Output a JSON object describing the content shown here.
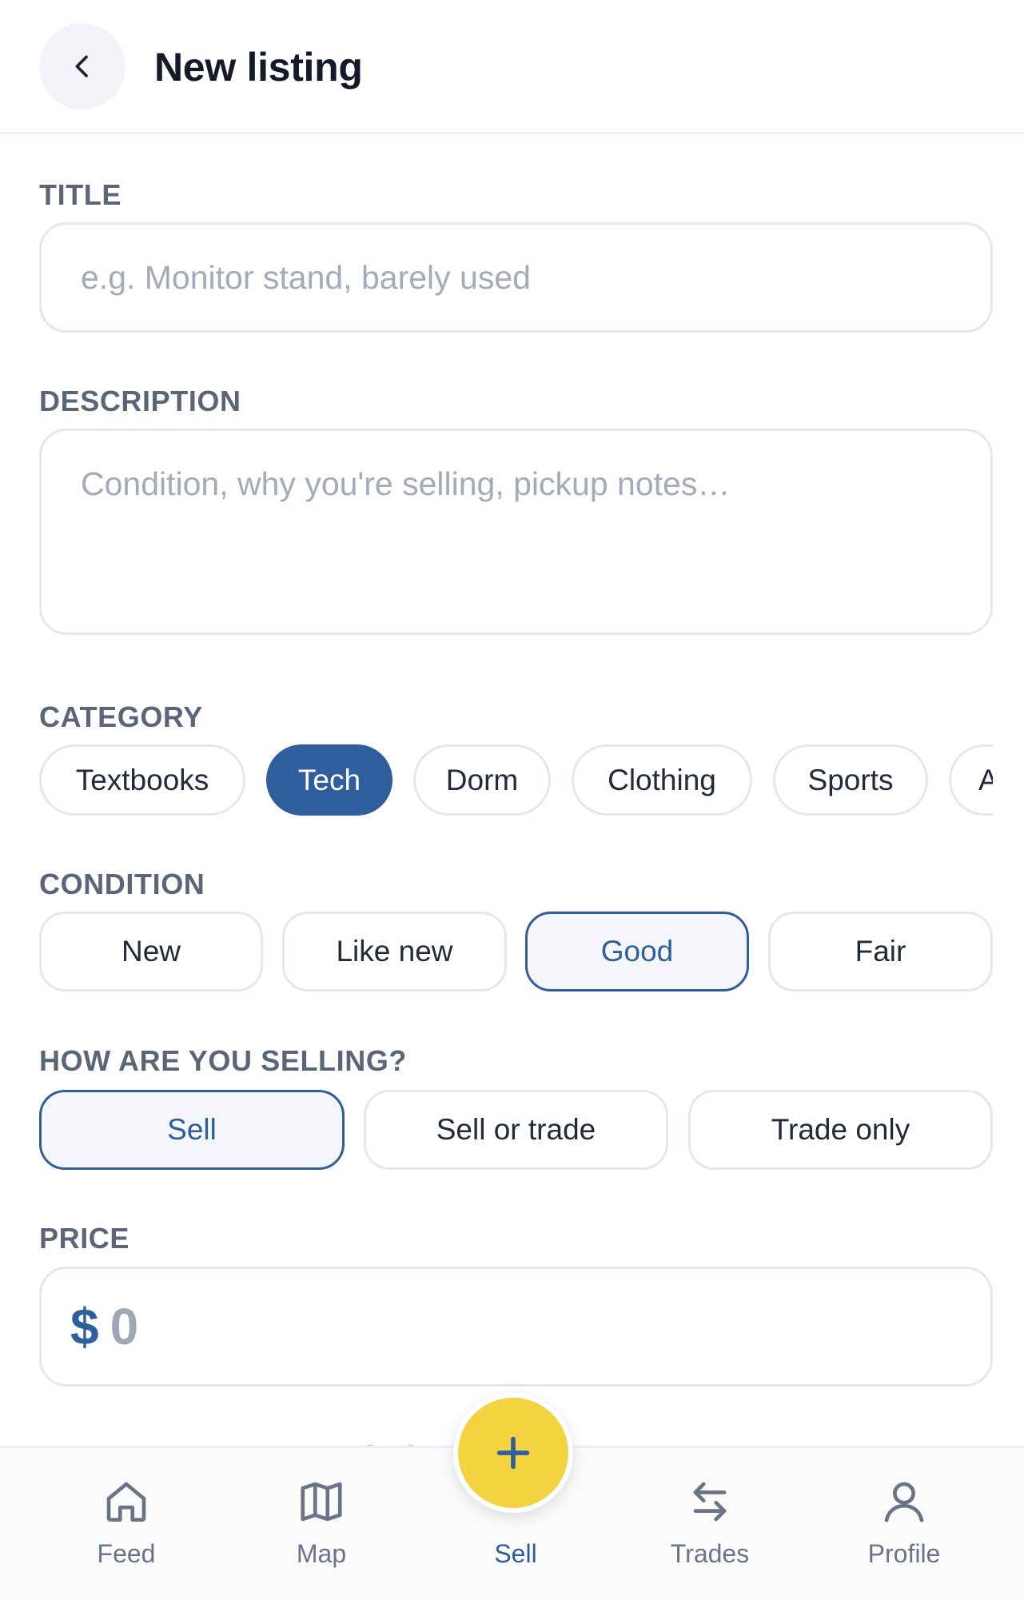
{
  "header": {
    "title": "New listing",
    "back_icon": "chevron-left-icon"
  },
  "form": {
    "title": {
      "label": "TITLE",
      "placeholder": "e.g. Monitor stand, barely used",
      "value": ""
    },
    "description": {
      "label": "DESCRIPTION",
      "placeholder": "Condition, why you're selling, pickup notes…",
      "value": ""
    },
    "category": {
      "label": "CATEGORY",
      "selected": "Tech",
      "options": [
        "Textbooks",
        "Tech",
        "Dorm",
        "Clothing",
        "Sports",
        "A"
      ]
    },
    "condition": {
      "label": "CONDITION",
      "selected": "Good",
      "options": [
        "New",
        "Like new",
        "Good",
        "Fair"
      ]
    },
    "selling_mode": {
      "label": "HOW ARE YOU SELLING?",
      "selected": "Sell",
      "options": [
        "Sell",
        "Sell or trade",
        "Trade only"
      ]
    },
    "price": {
      "label": "PRICE",
      "currency": "$",
      "placeholder": "0",
      "value": ""
    },
    "meetup_label_partial": "PREFERRED MEETUP SPOT"
  },
  "colors": {
    "accent": "#2f5e9c",
    "fab": "#f3d33f",
    "border": "#e4e7ed",
    "muted_text": "#5b6578"
  },
  "bottom_nav": {
    "items": [
      {
        "label": "Feed",
        "icon": "home-icon"
      },
      {
        "label": "Map",
        "icon": "map-icon"
      },
      {
        "label": "Sell",
        "icon": "plus-icon",
        "active": true
      },
      {
        "label": "Trades",
        "icon": "swap-arrows-icon"
      },
      {
        "label": "Profile",
        "icon": "user-icon"
      }
    ]
  }
}
